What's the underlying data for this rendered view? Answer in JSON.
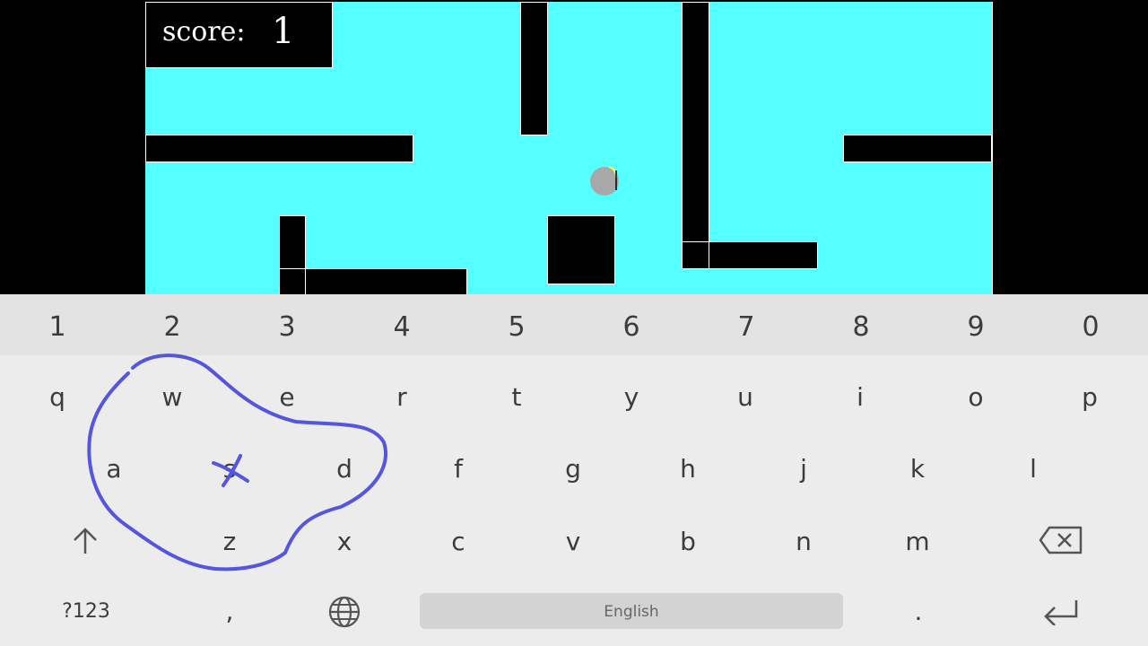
{
  "game": {
    "score_label": "score:",
    "score_value": "1",
    "colors": {
      "background": "#55FFFF",
      "wall": "#000000",
      "ball": "#A8A8A8"
    }
  },
  "keyboard": {
    "number_row": [
      "1",
      "2",
      "3",
      "4",
      "5",
      "6",
      "7",
      "8",
      "9",
      "0"
    ],
    "row1": [
      "q",
      "w",
      "e",
      "r",
      "t",
      "y",
      "u",
      "i",
      "o",
      "p"
    ],
    "row2": [
      "a",
      "s",
      "d",
      "f",
      "g",
      "h",
      "j",
      "k",
      "l"
    ],
    "row3": [
      "z",
      "x",
      "c",
      "v",
      "b",
      "n",
      "m"
    ],
    "symbols_label": "?123",
    "comma": ",",
    "space_label": "English",
    "period": ".",
    "icons": {
      "shift": "shift-arrow-icon",
      "backspace": "backspace-icon",
      "language": "globe-icon",
      "enter": "enter-arrow-icon"
    },
    "annotation_color": "#5555DD"
  }
}
